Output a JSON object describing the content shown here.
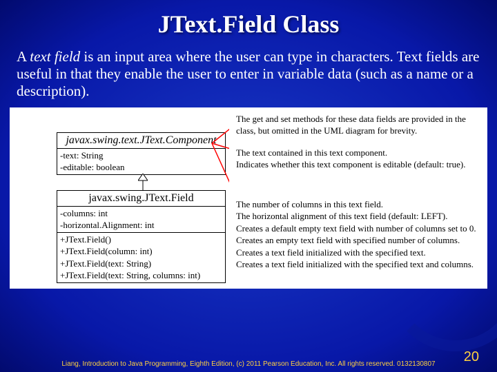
{
  "title": "JText.Field Class",
  "intro_prefix": "A ",
  "intro_em": "text field",
  "intro_rest": " is an input area where the user can type in characters. Text fields are useful in that they enable the user to enter in variable data (such as a name or a description).",
  "uml": {
    "class1": {
      "name": "javax.swing.text.JText.Component",
      "attrs": [
        "-text: String",
        "-editable: boolean"
      ]
    },
    "class2": {
      "name": "javax.swing.JText.Field",
      "attrs": [
        "-columns: int",
        "-horizontal.Alignment: int"
      ],
      "ops": [
        "+JText.Field()",
        "+JText.Field(column: int)",
        "+JText.Field(text: String)",
        "+JText.Field(text: String, columns: int)"
      ]
    }
  },
  "notes": {
    "brevity": "The get and set methods for these data fields are provided in the class, but omitted in the UML diagram for brevity.",
    "text_attr": "The text contained in this text component.",
    "editable_attr": "Indicates whether this text component is editable (default: true).",
    "columns_attr": "The number of columns in this text field.",
    "halign_attr": "The horizontal alignment of this text field (default: LEFT).",
    "ctor0": "Creates a default empty text field with number of columns set to 0.",
    "ctor1": "Creates an empty text field with specified number of columns.",
    "ctor2": "Creates a text field initialized with the specified text.",
    "ctor3": "Creates a text field initialized with the specified text and columns."
  },
  "footer": "Liang, Introduction to Java Programming, Eighth Edition, (c) 2011 Pearson Education, Inc. All rights reserved. 0132130807",
  "page": "20"
}
